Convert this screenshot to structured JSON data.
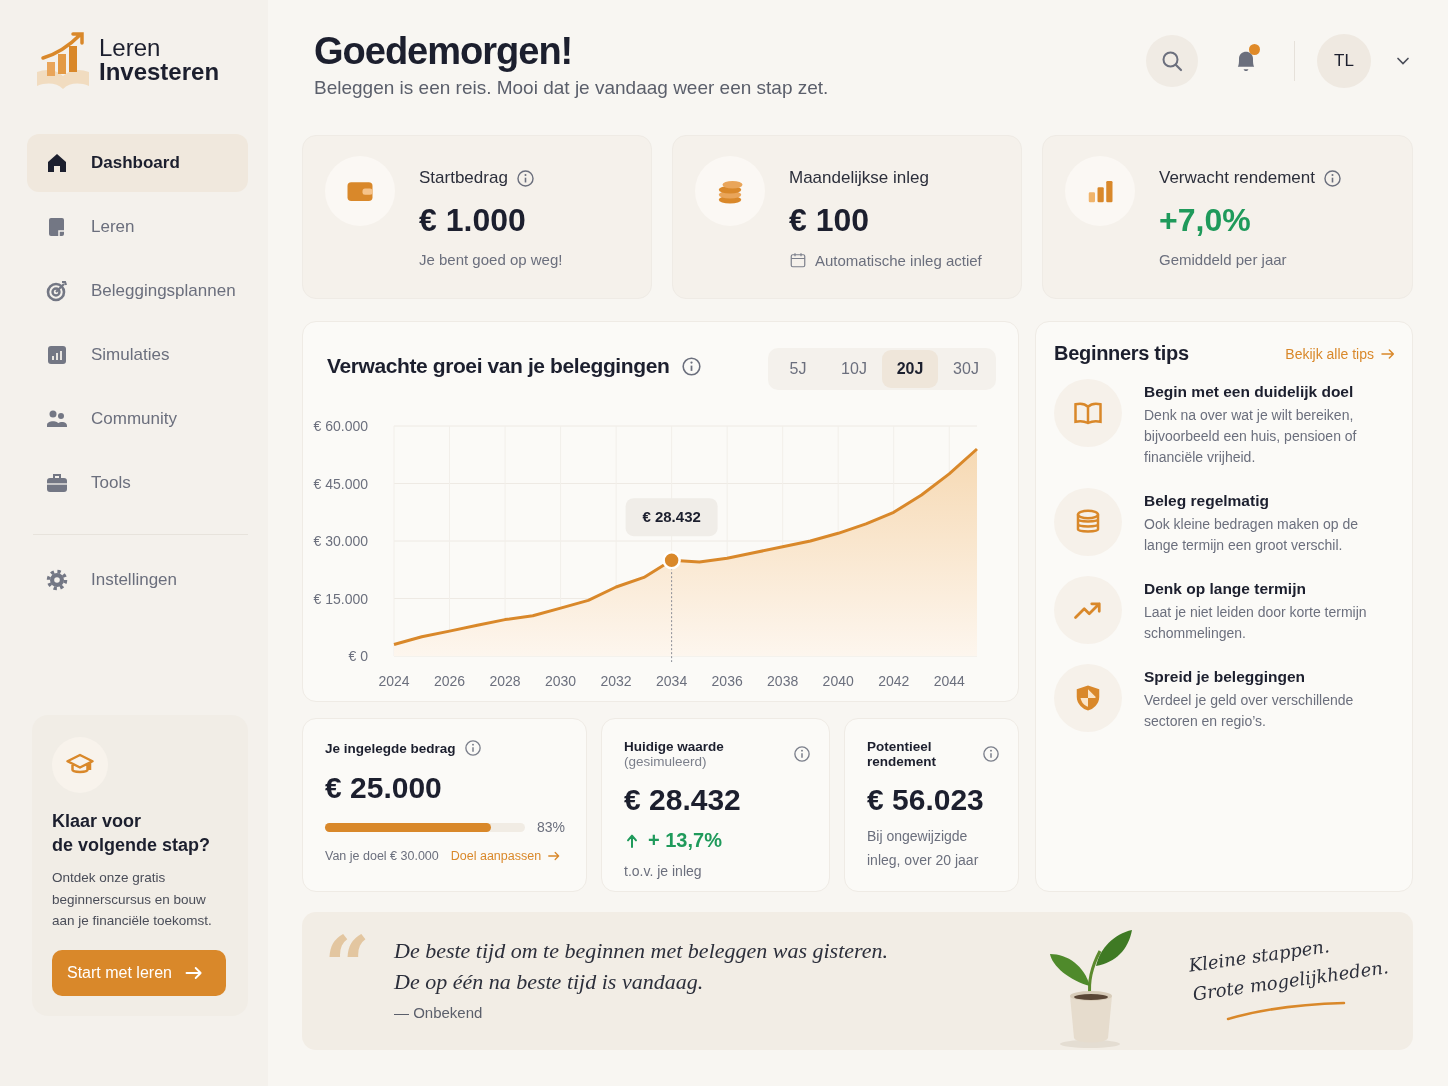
{
  "brand": {
    "line1": "Leren",
    "line2": "Investeren"
  },
  "nav": [
    {
      "label": "Dashboard",
      "selected": true
    },
    {
      "label": "Leren",
      "selected": false
    },
    {
      "label": "Beleggingsplannen",
      "selected": false
    },
    {
      "label": "Simulaties",
      "selected": false
    },
    {
      "label": "Community",
      "selected": false
    },
    {
      "label": "Tools",
      "selected": false
    }
  ],
  "settings_nav": [
    {
      "label": "Instellingen",
      "selected": false
    }
  ],
  "promo": {
    "title": "Klaar voor\nde volgende stap?",
    "text": "Ontdek onze gratis beginnerscursus en bouw aan je financiële toekomst.",
    "button": "Start met leren"
  },
  "header": {
    "title": "Goedemorgen!",
    "subtitle": "Beleggen is een reis. Mooi dat je vandaag weer een stap zet.",
    "unread_notifications": true,
    "avatar": "TL"
  },
  "stats": [
    {
      "kind": "plain",
      "label": "Startbedrag",
      "info": true,
      "value": "€ 1.000",
      "note": "Je bent goed op weg!"
    },
    {
      "kind": "scheduled",
      "label": "Maandelijkse inleg",
      "info": false,
      "value": "€ 100",
      "note": "Automatische inleg actief"
    },
    {
      "kind": "positive",
      "label": "Verwacht rendement",
      "info": true,
      "value": "+7,0%",
      "note": "Gemiddeld per jaar"
    }
  ],
  "growth": {
    "title": "Verwachte groei van je beleggingen",
    "periods": [
      {
        "label": "5J",
        "selected": false
      },
      {
        "label": "10J",
        "selected": false
      },
      {
        "label": "20J",
        "selected": true
      },
      {
        "label": "30J",
        "selected": false
      }
    ],
    "chart_data": {
      "type": "area",
      "grid": true,
      "x": [
        2024,
        2025,
        2026,
        2027,
        2028,
        2029,
        2030,
        2031,
        2032,
        2033,
        2034,
        2035,
        2036,
        2037,
        2038,
        2039,
        2040,
        2041,
        2042,
        2043,
        2044,
        2045
      ],
      "series": [
        {
          "color": "#d9882a",
          "values": [
            3000,
            5000,
            6500,
            8000,
            9500,
            10500,
            12500,
            14500,
            18000,
            20500,
            25000,
            24500,
            25500,
            27000,
            28500,
            30000,
            32000,
            34500,
            37500,
            42000,
            47500,
            54000
          ]
        }
      ],
      "xlim": [
        2024,
        2045
      ],
      "ylim": [
        0,
        60000
      ],
      "xticks": [
        2024,
        2026,
        2028,
        2030,
        2032,
        2034,
        2036,
        2038,
        2040,
        2042,
        2044
      ],
      "yticks": [
        {
          "value": 0,
          "label": "€ 0"
        },
        {
          "value": 15000,
          "label": "€ 15.000"
        },
        {
          "value": 30000,
          "label": "€ 30.000"
        },
        {
          "value": 45000,
          "label": "€ 45.000"
        },
        {
          "value": 60000,
          "label": "€ 60.000"
        }
      ],
      "ref_lines": [
        {
          "axis": "x",
          "value": 2034
        }
      ],
      "annotations": [
        {
          "x": 2034,
          "y": 25000,
          "text": "€ 28.432"
        }
      ]
    }
  },
  "summary": [
    {
      "kind": "progress",
      "title": "Je ingelegde bedrag",
      "value": "€ 25.000",
      "level": 0.83,
      "reading": "83%",
      "note": "Van je doel € 30.000",
      "link": "Doel aanpassen"
    },
    {
      "kind": "change",
      "title": "Huidige waarde",
      "title_note": "(gesimuleerd)",
      "value": "€ 28.432",
      "change": "+ 13,7%",
      "note": "t.o.v. je inleg"
    },
    {
      "kind": "plain",
      "title": "Potentieel rendement",
      "value": "€ 56.023",
      "note": "Bij ongewijzigde inleg, over 20 jaar"
    }
  ],
  "tips": {
    "title": "Beginners tips",
    "link": "Bekijk alle tips",
    "items": [
      {
        "title": "Begin met een duidelijk doel",
        "text": "Denk na over wat je wilt bereiken, bijvoorbeeld een huis, pensioen of financiële vrijheid."
      },
      {
        "title": "Beleg regelmatig",
        "text": "Ook kleine bedragen maken op de lange termijn een groot verschil."
      },
      {
        "title": "Denk op lange termijn",
        "text": "Laat je niet leiden door korte termijn schommelingen."
      },
      {
        "title": "Spreid je beleggingen",
        "text": "Verdeel je geld over verschillende sectoren en regio’s."
      }
    ]
  },
  "quote": {
    "mark": "“",
    "lines": "De beste tijd om te beginnen met beleggen was gisteren.\nDe op één na beste tijd is vandaag.",
    "author": "— Onbekend",
    "slogan": "Kleine stappen.\nGrote mogelijkheden."
  }
}
